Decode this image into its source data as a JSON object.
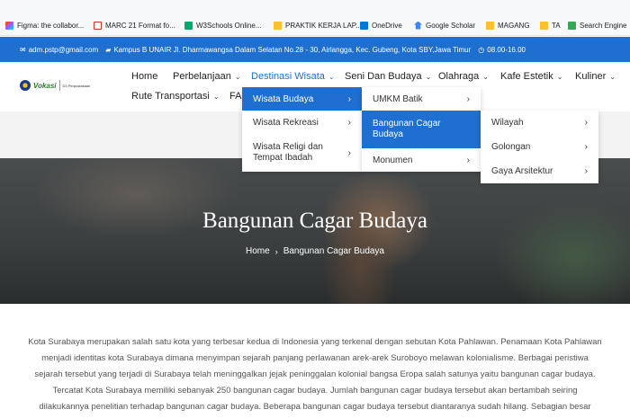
{
  "bookmarks": [
    {
      "icon": "figma-icon",
      "label": "Figma: the collabor..."
    },
    {
      "icon": "marc-icon",
      "label": "MARC 21 Format fo..."
    },
    {
      "icon": "w3schools-icon",
      "label": "W3Schools Online..."
    },
    {
      "icon": "folder-icon",
      "label": "PRAKTIK KERJA LAP..."
    },
    {
      "icon": "onedrive-icon",
      "label": "OneDrive"
    },
    {
      "icon": "google-scholar-icon",
      "label": "Google Scholar"
    },
    {
      "icon": "folder-icon",
      "label": "MAGANG"
    },
    {
      "icon": "folder-icon",
      "label": "TA"
    },
    {
      "icon": "search-icon",
      "label": "Search Engine"
    }
  ],
  "topbar": {
    "email": "adm.pstp@gmail.com",
    "address": "Kampus B UNAIR Jl. Dharmawangsa Dalam Selatan No.28 - 30, Airlangga, Kec. Gubeng, Kota SBY,Jawa Timur",
    "hours": "08.00-16.00"
  },
  "logo": {
    "brand": "Vokasi",
    "sub": "D3 Perpustakaan"
  },
  "nav": {
    "home": "Home",
    "belanja": "Perbelanjaan",
    "wisata": "Destinasi Wisata",
    "seni": "Seni Dan Budaya",
    "olahraga": "Olahraga",
    "kafe": "Kafe Estetik",
    "kuliner": "Kuliner",
    "rute": "Rute Transportasi",
    "faq": "FAQ"
  },
  "menu1": {
    "budaya": "Wisata Budaya",
    "rekreasi": "Wisata Rekreasi",
    "religi_1": "Wisata Religi dan",
    "religi_2": "Tempat Ibadah"
  },
  "menu2": {
    "umkm": "UMKM Batik",
    "cagar_1": "Bangunan Cagar",
    "cagar_2": "Budaya",
    "monumen": "Monumen"
  },
  "menu3": {
    "wilayah": "Wilayah",
    "golongan": "Golongan",
    "gaya": "Gaya Arsitektur"
  },
  "hero": {
    "title": "Bangunan Cagar Budaya",
    "crumb_home": "Home",
    "crumb_current": "Bangunan Cagar Budaya"
  },
  "body": {
    "line1": "Kota Surabaya merupakan salah satu kota yang terbesar kedua di Indonesia yang terkenal dengan sebutan Kota Pahlawan. Penamaan Kota Pahlawan",
    "line2": "menjadi identitas kota Surabaya dimana menyimpan sejarah panjang perlawanan arek-arek Suroboyo melawan kolonialisme.  Berbagai peristiwa",
    "line3": "sejarah tersebut yang terjadi di Surabaya telah meninggalkan jejak peninggalan kolonial bangsa Eropa salah satunya yaitu bangunan cagar budaya.",
    "line4": "Tercatat Kota Surabaya memiliki sebanyak 250 bangunan cagar budaya. Jumlah bangunan cagar budaya tersebut akan bertambah seiring",
    "line5": "dilakukannya penelitian terhadap bangunan cagar budaya. Beberapa bangunan cagar budaya tersebut diantaranya sudah hilang. Sebagian besar"
  },
  "colors": {
    "primary": "#1f6fd1",
    "text": "#555555"
  }
}
